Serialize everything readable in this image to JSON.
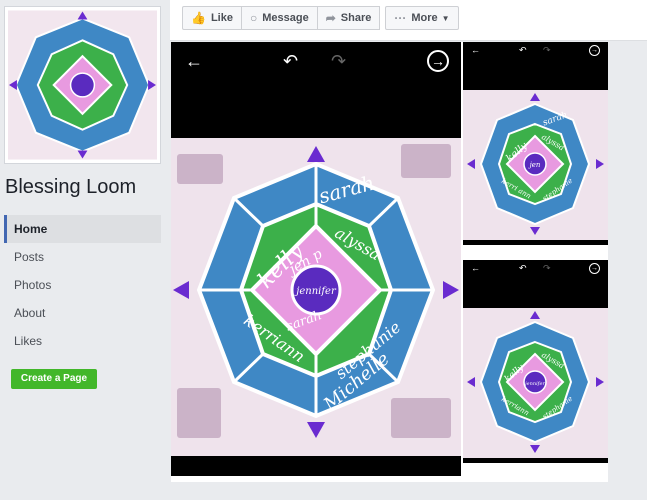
{
  "page": {
    "name": "Blessing Loom"
  },
  "nav": {
    "items": [
      "Home",
      "Posts",
      "Photos",
      "About",
      "Likes"
    ],
    "active": "Home"
  },
  "create_page_label": "Create a Page",
  "actions": {
    "like": "Like",
    "message": "Message",
    "share": "Share",
    "more": "More"
  },
  "photo_text": {
    "big": {
      "outer": [
        "sarah",
        "Michelle"
      ],
      "middle": [
        "kelly",
        "alyssa",
        "kerriann",
        "stephanie"
      ],
      "inner": [
        "jen p",
        "sarah"
      ],
      "center": "jennifer"
    },
    "thumb1": {
      "outer": [
        "sarah"
      ],
      "middle": [
        "kelly",
        "alyssa",
        "kerri ann",
        "stephanie"
      ],
      "center": "jen"
    },
    "thumb2": {
      "outer": [],
      "middle": [
        "kelly",
        "alyssa",
        "kerriann",
        "stephanie"
      ],
      "center": "jennifer"
    }
  },
  "colors": {
    "outer": "#3f88c5",
    "middle": "#3cb04a",
    "inner": "#e89ae0",
    "center": "#5a2bbf",
    "arrow": "#6a2bd0",
    "accent": "#4267b2",
    "create": "#42b72a"
  }
}
